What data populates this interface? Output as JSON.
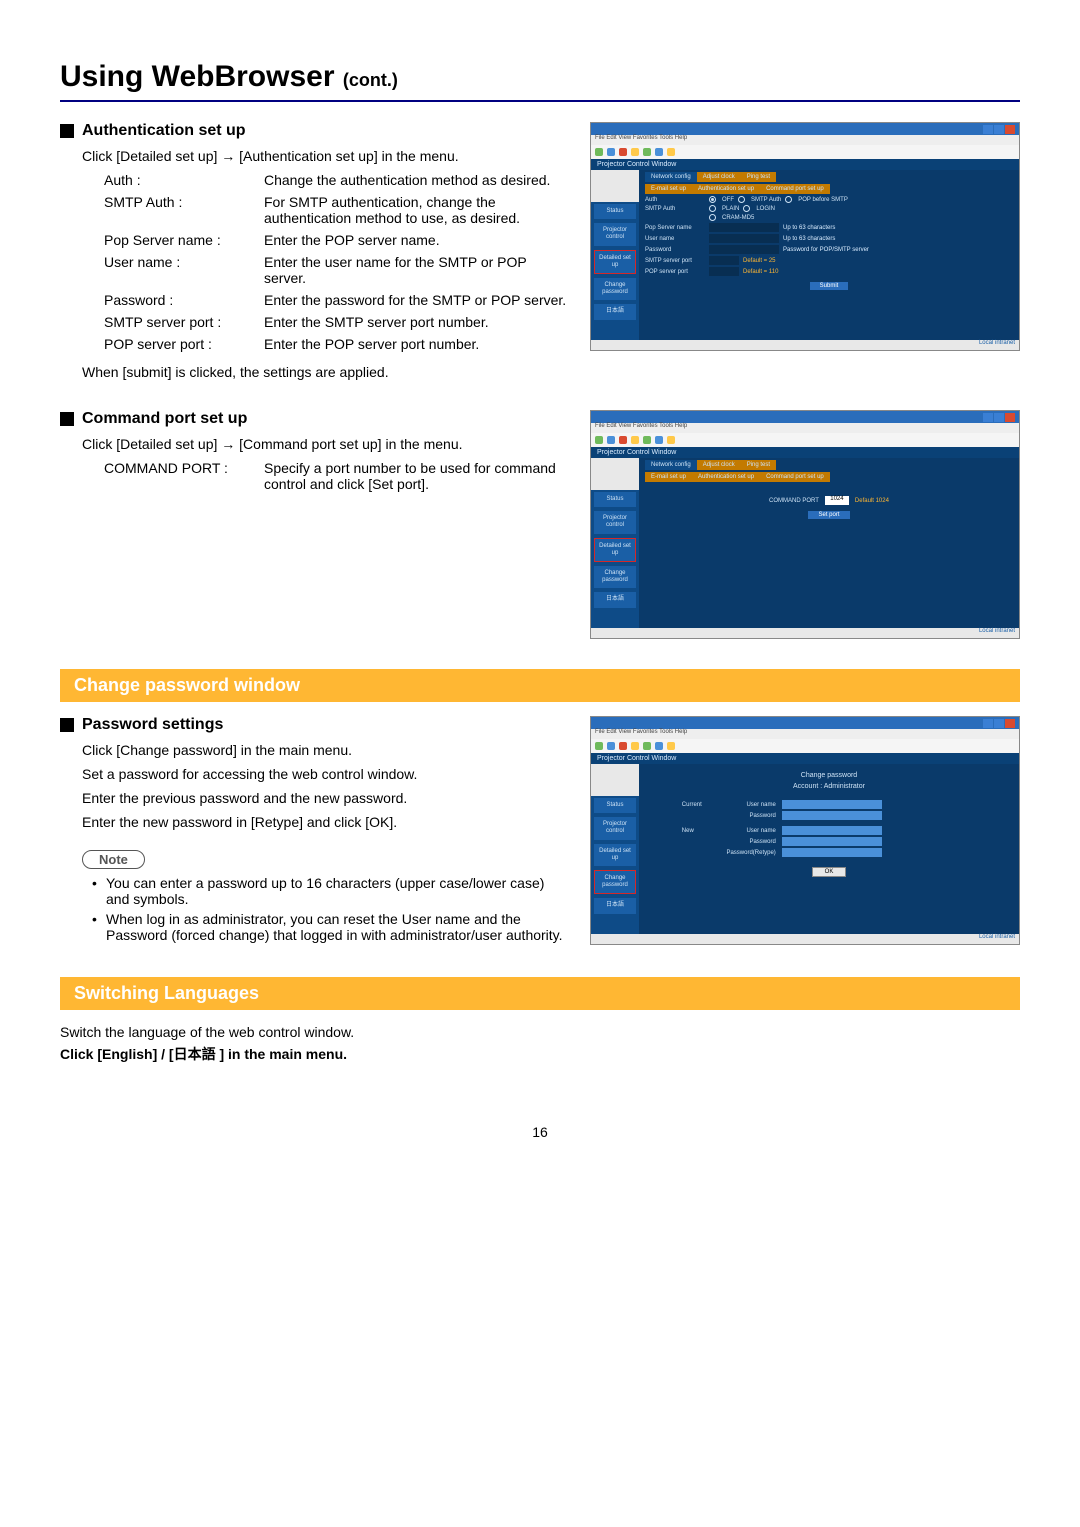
{
  "page_number": "16",
  "title_main": "Using WebBrowser ",
  "title_cont": "(cont.)",
  "auth": {
    "heading": "Authentication set up",
    "intro": "Click [Detailed set up] → [Authentication set up] in the menu.",
    "rows": [
      {
        "term": "Auth :",
        "def": "Change the authentication method as desired."
      },
      {
        "term": "SMTP Auth :",
        "def": "For SMTP authentication, change the authentication method to use, as desired."
      },
      {
        "term": "Pop Server name :",
        "def": "Enter the POP server name."
      },
      {
        "term": "User name :",
        "def": "Enter the user name for the SMTP or POP server."
      },
      {
        "term": "Password :",
        "def": "Enter the password for the SMTP or POP server."
      },
      {
        "term": "SMTP server port :",
        "def": "Enter the SMTP server port number."
      },
      {
        "term": "POP server port :",
        "def": "Enter the POP server port number."
      }
    ],
    "closing": "When [submit] is clicked, the settings are applied."
  },
  "cmd": {
    "heading": "Command port set up",
    "intro": "Click [Detailed set up] → [Command port set up] in the menu.",
    "rows": [
      {
        "term": "COMMAND PORT :",
        "def": "Specify a port number to be used for command control and click [Set port]."
      }
    ]
  },
  "change_pw_band": "Change password window",
  "pwset": {
    "heading": "Password settings",
    "line1": "Click [Change password] in the main menu.",
    "line2": "Set a password for accessing the web control window.",
    "line3": "Enter the previous password and the new password.",
    "line4": "Enter the new password in [Retype] and click [OK].",
    "note_label": "Note",
    "notes": [
      "You can enter a password up to 16 characters (upper case/lower case) and symbols.",
      "When log in as administrator, you can reset the User name and the Password (forced change) that logged in with administrator/user authority."
    ]
  },
  "switch_lang_band": "Switching Languages",
  "switch": {
    "line1": "Switch the language of the web control window.",
    "line2": "Click [English] / [日本語 ] in the main menu."
  },
  "shot_common": {
    "menubar": "File  Edit  View  Favorites  Tools  Help",
    "pcw": "Projector Control Window",
    "sidebar": {
      "status": "Status",
      "projector_control": "Projector control",
      "detailed_setup": "Detailed set up",
      "change_password": "Change password",
      "lang": "日本語"
    },
    "tabs": {
      "network": "Network config",
      "adjust": "Adjust clock",
      "ping": "Ping test",
      "email": "E-mail set up",
      "auth": "Authentication set up",
      "cmdport": "Command port set up"
    },
    "status_intranet": "Local intranet"
  },
  "shot_auth": {
    "auth_label": "Auth",
    "auth_off": "OFF",
    "auth_smtp": "SMTP Auth",
    "auth_popbefore": "POP before SMTP",
    "smtp_auth_label": "SMTP Auth",
    "plain": "PLAIN",
    "login": "LOGIN",
    "crammd5": "CRAM-MD5",
    "popserver": "Pop Server name",
    "username": "User name",
    "password": "Password",
    "smtp_port": "SMTP server port",
    "pop_port": "POP server port",
    "hint_pop": "Up to 63 characters",
    "hint_user": "Up to 63 characters",
    "hint_pass": "Password for POP/SMTP server",
    "default25": "Default = 25",
    "default110": "Default = 110",
    "submit": "Submit"
  },
  "shot_cmd": {
    "cmdport": "COMMAND PORT",
    "value": "1024",
    "default": "Default  1024",
    "setport": "Set port"
  },
  "shot_pw": {
    "title": "Change password",
    "account": "Account : Administrator",
    "current": "Current",
    "new": "New",
    "username": "User name",
    "password": "Password",
    "retype": "Password(Retype)",
    "ok": "OK"
  }
}
